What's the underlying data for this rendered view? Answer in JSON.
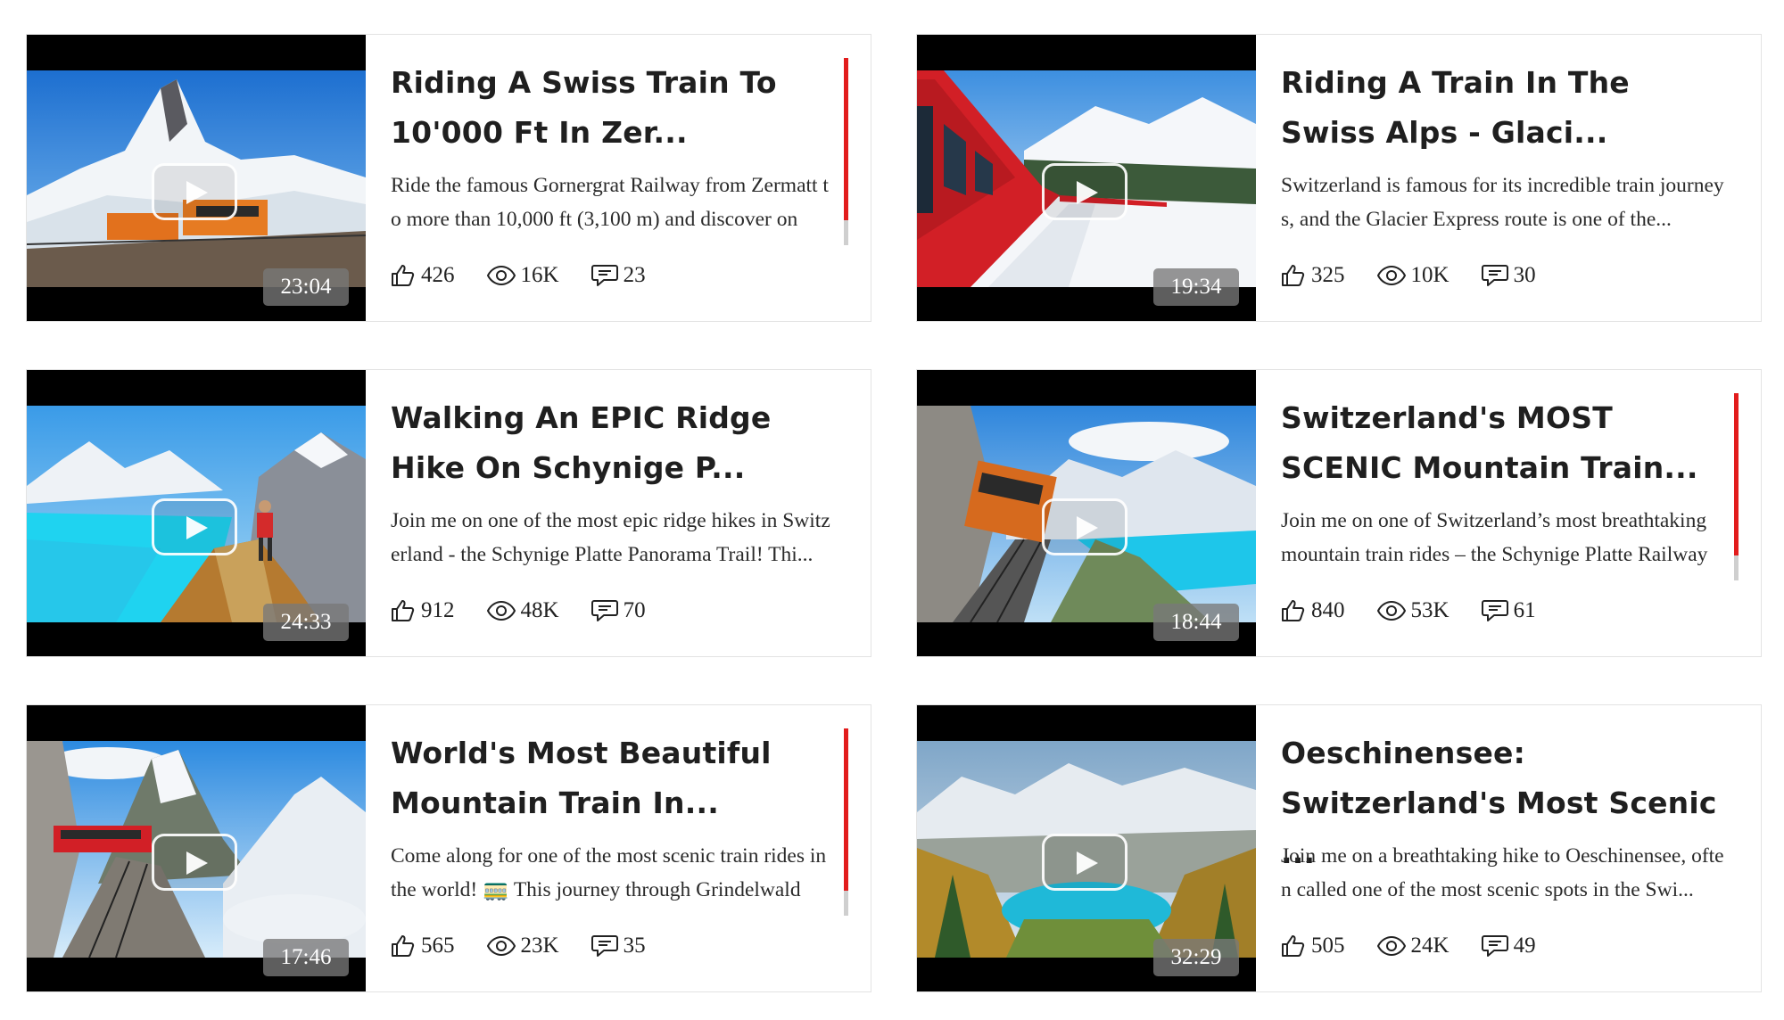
{
  "cards": [
    {
      "title": "Riding A Swiss Train To 10'000 Ft In Zer...",
      "description": "Ride the famous Gornergrat Railway from Zermatt to more than 10,000 ft (3,100 m) and discover on",
      "duration": "23:04",
      "likes": "426",
      "views": "16K",
      "comments": "23",
      "scrollbar_visible": true
    },
    {
      "title": "Riding A Train In The Swiss Alps - Glaci...",
      "description": "Switzerland is famous for its incredible train journeys, and the Glacier Express route is one of the...",
      "duration": "19:34",
      "likes": "325",
      "views": "10K",
      "comments": "30",
      "scrollbar_visible": false
    },
    {
      "title": "Walking An EPIC Ridge Hike On Schynige P...",
      "description": "Join me on one of the most epic ridge hikes in Switzerland - the Schynige Platte Panorama Trail! Thi...",
      "duration": "24:33",
      "likes": "912",
      "views": "48K",
      "comments": "70",
      "scrollbar_visible": false
    },
    {
      "title": "Switzerland's MOST SCENIC Mountain Train...",
      "description": "Join me on one of Switzerland’s most breathtaking mountain train rides – the Schynige Platte Railway",
      "duration": "18:44",
      "likes": "840",
      "views": "53K",
      "comments": "61",
      "scrollbar_visible": true
    },
    {
      "title": "World's Most Beautiful Mountain Train In...",
      "description": "Come along for one of the most scenic train rides in the world! 🚃 This journey through Grindelwald",
      "duration": "17:46",
      "likes": "565",
      "views": "23K",
      "comments": "35",
      "scrollbar_visible": true
    },
    {
      "title": "Oeschinensee: Switzerland's Most Scenic ...",
      "description": "Join me on a breathtaking hike to Oeschinensee, often called one of the most scenic spots in the Swi...",
      "duration": "32:29",
      "likes": "505",
      "views": "24K",
      "comments": "49",
      "scrollbar_visible": false
    }
  ],
  "colors": {
    "scrollbar_accent": "#e21c1c",
    "duration_badge": "#787878",
    "title_text": "#1f1f1f"
  },
  "icons": {
    "likes": "thumbs-up-icon",
    "views": "eye-icon",
    "comments": "comment-icon",
    "play": "play-icon"
  }
}
